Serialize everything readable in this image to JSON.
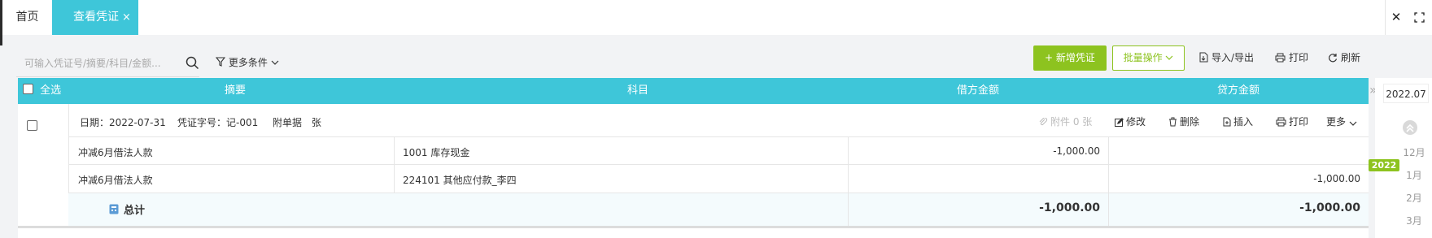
{
  "tabs": {
    "home": "首页",
    "active": "查看凭证",
    "close_glyph": "×"
  },
  "window": {
    "close_glyph": "✕"
  },
  "toolbar": {
    "search_placeholder": "可输入凭证号/摘要/科目/金额...",
    "more_conditions": "更多条件",
    "add_voucher": "新增凭证",
    "batch_ops": "批量操作",
    "import_export": "导入/导出",
    "print": "打印",
    "refresh": "刷新"
  },
  "table": {
    "headers": {
      "select_all": "全选",
      "summary": "摘要",
      "account": "科目",
      "debit": "借方金额",
      "credit": "贷方金额"
    },
    "voucher": {
      "date_label": "日期：2022-07-31",
      "number_label": "凭证字号：记-001",
      "attachments_label": "附单据",
      "attachments_unit": "张",
      "actions": {
        "attachment": "附件 0 张",
        "edit": "修改",
        "delete": "删除",
        "insert": "插入",
        "print": "打印",
        "more": "更多"
      },
      "rows": [
        {
          "summary": "冲减6月借法人款",
          "account": "1001 库存现金",
          "debit": "-1,000.00",
          "credit": ""
        },
        {
          "summary": "冲减6月借法人款",
          "account": "224101 其他应付款_李四",
          "debit": "",
          "credit": "-1,000.00"
        }
      ],
      "total": {
        "label": "总计",
        "debit": "-1,000.00",
        "credit": "-1,000.00"
      }
    }
  },
  "timeline": {
    "current_period": "2022.07",
    "items": [
      "12月",
      "1月",
      "2月",
      "3月"
    ],
    "year_badge": "2022"
  },
  "colors": {
    "accent": "#3ec6d9",
    "brand_green": "#8dc31f"
  }
}
